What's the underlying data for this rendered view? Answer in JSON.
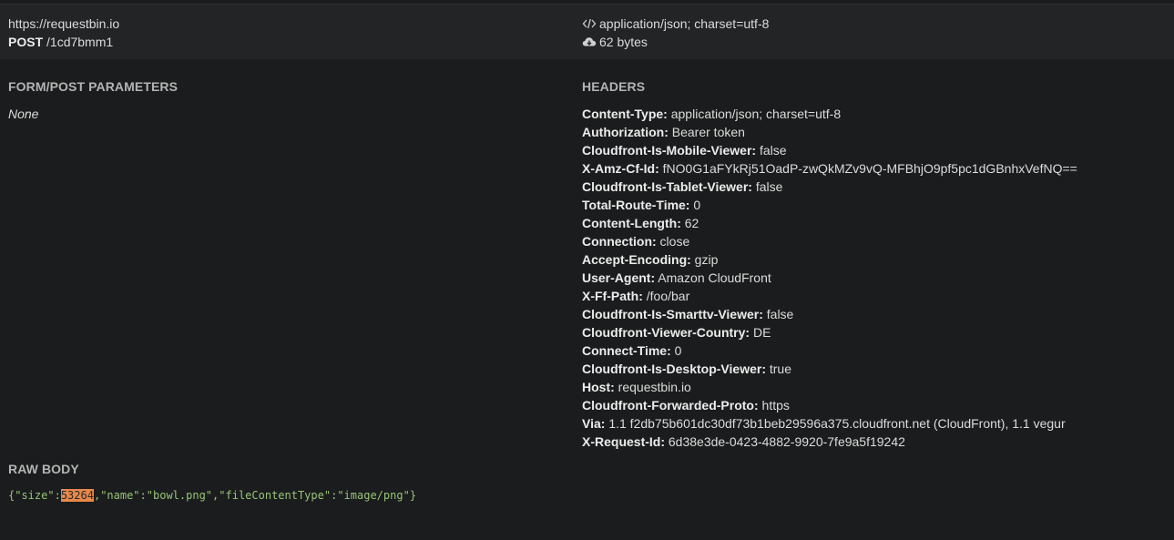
{
  "summary": {
    "host": "https://requestbin.io",
    "method": "POST",
    "path": "/1cd7bmm1",
    "content_type": "application/json; charset=utf-8",
    "size": "62 bytes",
    "code_icon": "code-icon",
    "cloud_icon": "cloud-download-icon"
  },
  "form": {
    "title": "FORM/POST PARAMETERS",
    "value": "None"
  },
  "headers": {
    "title": "HEADERS",
    "items": [
      {
        "key": "Content-Type:",
        "value": "application/json; charset=utf-8"
      },
      {
        "key": "Authorization:",
        "value": "Bearer token"
      },
      {
        "key": "Cloudfront-Is-Mobile-Viewer:",
        "value": "false"
      },
      {
        "key": "X-Amz-Cf-Id:",
        "value": "fNO0G1aFYkRj51OadP-zwQkMZv9vQ-MFBhjO9pf5pc1dGBnhxVefNQ=="
      },
      {
        "key": "Cloudfront-Is-Tablet-Viewer:",
        "value": "false"
      },
      {
        "key": "Total-Route-Time:",
        "value": "0"
      },
      {
        "key": "Content-Length:",
        "value": "62"
      },
      {
        "key": "Connection:",
        "value": "close"
      },
      {
        "key": "Accept-Encoding:",
        "value": "gzip"
      },
      {
        "key": "User-Agent:",
        "value": "Amazon CloudFront"
      },
      {
        "key": "X-Ff-Path:",
        "value": "/foo/bar"
      },
      {
        "key": "Cloudfront-Is-Smarttv-Viewer:",
        "value": "false"
      },
      {
        "key": "Cloudfront-Viewer-Country:",
        "value": "DE"
      },
      {
        "key": "Connect-Time:",
        "value": "0"
      },
      {
        "key": "Cloudfront-Is-Desktop-Viewer:",
        "value": "true"
      },
      {
        "key": "Host:",
        "value": "requestbin.io"
      },
      {
        "key": "Cloudfront-Forwarded-Proto:",
        "value": "https"
      },
      {
        "key": "Via:",
        "value": "1.1 f2db75b601dc30df73b1beb29596a375.cloudfront.net (CloudFront), 1.1 vegur"
      },
      {
        "key": "X-Request-Id:",
        "value": "6d38e3de-0423-4882-9920-7fe9a5f19242"
      }
    ]
  },
  "raw_body": {
    "title": "RAW BODY",
    "open_brace": "{",
    "k_size": "\"size\"",
    "colon1": ":",
    "v_size": "53264",
    "comma1": ",",
    "k_name": "\"name\"",
    "colon2": ":",
    "v_name": "\"bowl.png\"",
    "comma2": ",",
    "k_type": "\"fileContentType\"",
    "colon3": ":",
    "v_type": "\"image/png\"",
    "close_brace": "}"
  }
}
